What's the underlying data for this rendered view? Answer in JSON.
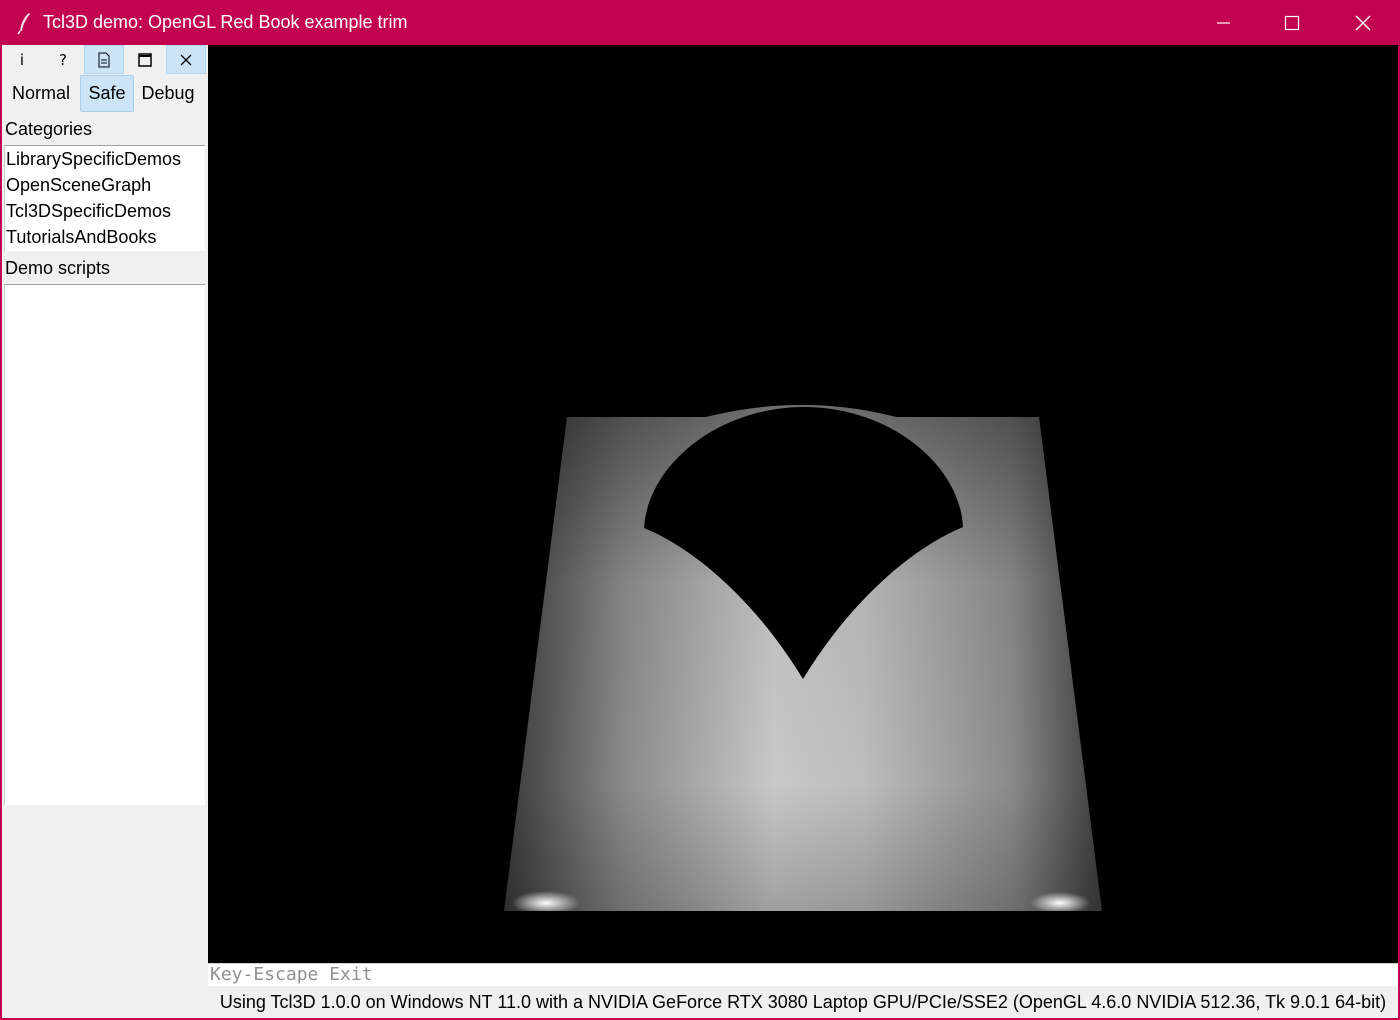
{
  "window": {
    "title": "Tcl3D demo: OpenGL Red Book example trim",
    "icon": "feather-icon",
    "controls": [
      "minimize-icon",
      "maximize-icon",
      "close-icon"
    ]
  },
  "toolbar": {
    "icons": [
      {
        "name": "info-icon",
        "glyph": "i"
      },
      {
        "name": "help-icon",
        "glyph": "?"
      },
      {
        "name": "document-icon",
        "glyph": "⎗"
      },
      {
        "name": "window-icon",
        "glyph": "□"
      },
      {
        "name": "close-tool-icon",
        "glyph": "✕"
      }
    ]
  },
  "modes": {
    "normal": "Normal",
    "safe": "Safe",
    "debug": "Debug",
    "selected": "Safe"
  },
  "categories": {
    "label": "Categories",
    "items": [
      "LibrarySpecificDemos",
      "OpenSceneGraph",
      "Tcl3DSpecificDemos",
      "TutorialsAndBooks"
    ]
  },
  "demo_scripts": {
    "label": "Demo scripts",
    "items": []
  },
  "info_line": "Key-Escape Exit",
  "status_line": "Using Tcl3D 1.0.0 on Windows NT 11.0 with a NVIDIA GeForce RTX 3080 Laptop GPU/PCIe/SSE2 (OpenGL 4.6.0 NVIDIA 512.36, Tk 9.0.1 64-bit)",
  "colors": {
    "titlebar": "#c2034f",
    "selection": "#cce4f7",
    "canvas": "#000000"
  }
}
